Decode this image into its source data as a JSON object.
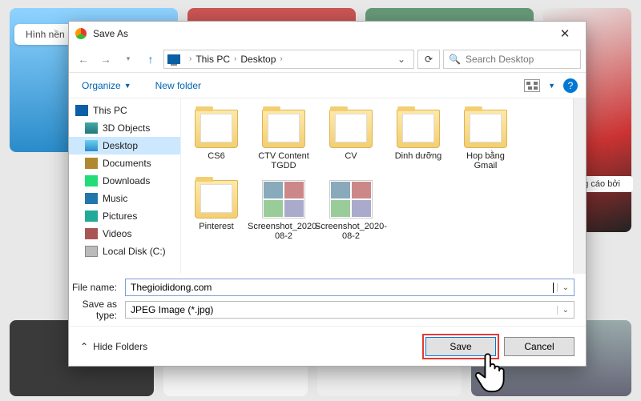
{
  "background": {
    "tab_label": "Hình nền",
    "ad_text": "àng cáo bởi"
  },
  "dialog": {
    "title": "Save As",
    "path": {
      "root": "This PC",
      "folder": "Desktop"
    },
    "search": {
      "placeholder": "Search Desktop"
    },
    "toolbar": {
      "organize": "Organize",
      "new_folder": "New folder",
      "help": "?"
    },
    "tree": {
      "root": "This PC",
      "items": [
        {
          "label": "3D Objects"
        },
        {
          "label": "Desktop"
        },
        {
          "label": "Documents"
        },
        {
          "label": "Downloads"
        },
        {
          "label": "Music"
        },
        {
          "label": "Pictures"
        },
        {
          "label": "Videos"
        },
        {
          "label": "Local Disk (C:)"
        }
      ]
    },
    "files": [
      {
        "name": "CS6",
        "type": "folder"
      },
      {
        "name": "CTV Content TGDD",
        "type": "folder"
      },
      {
        "name": "CV",
        "type": "folder"
      },
      {
        "name": "Dinh dưỡng",
        "type": "folder"
      },
      {
        "name": "Hop bằng Gmail",
        "type": "folder"
      },
      {
        "name": "Pinterest",
        "type": "folder"
      },
      {
        "name": "Screenshot_2020-08-2",
        "type": "image"
      },
      {
        "name": "Screenshot_2020-08-2",
        "type": "image"
      }
    ],
    "filename_label": "File name:",
    "filename_value": "Thegioididong.com",
    "type_label": "Save as type:",
    "type_value": "JPEG Image (*.jpg)",
    "hide_folders": "Hide Folders",
    "save": "Save",
    "cancel": "Cancel"
  }
}
